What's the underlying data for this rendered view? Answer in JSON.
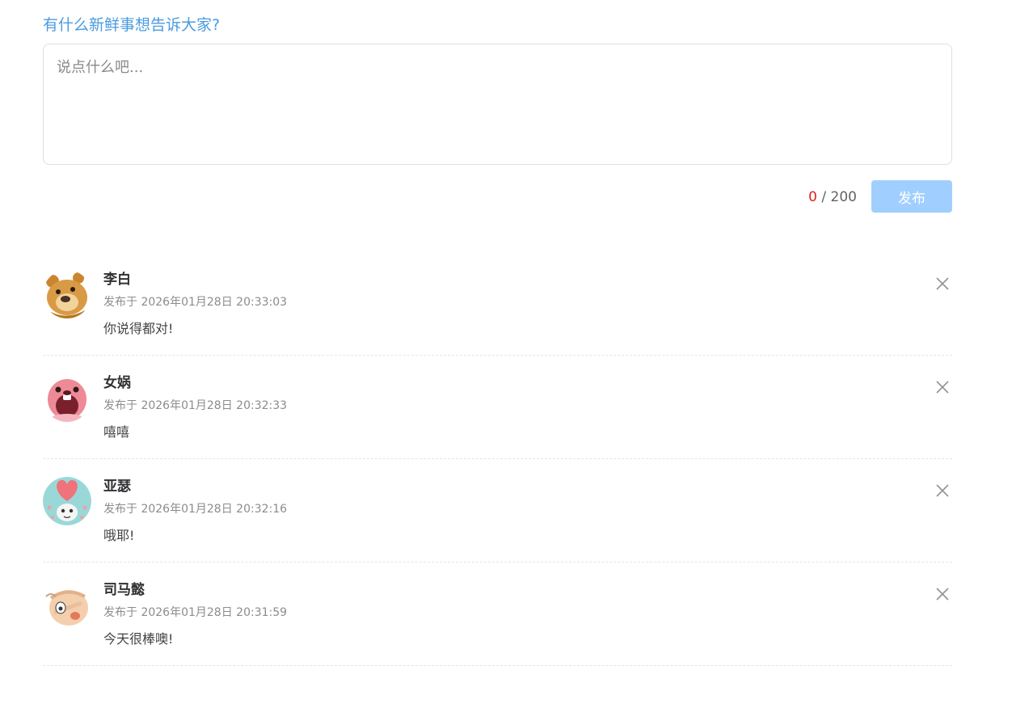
{
  "composer": {
    "prompt": "有什么新鲜事想告诉大家?",
    "placeholder": "说点什么吧...",
    "count_current": "0",
    "count_separator": " / ",
    "count_max": "200",
    "publish_label": "发布"
  },
  "comments": [
    {
      "avatar_icon": "bear-avatar-icon",
      "name": "李白",
      "time": "发布于 2026年01月28日 20:33:03",
      "content": "你说得都对!",
      "delete_icon": "close-icon"
    },
    {
      "avatar_icon": "pink-beaver-avatar-icon",
      "name": "女娲",
      "time": "发布于 2026年01月28日 20:32:33",
      "content": "嘻嘻",
      "delete_icon": "close-icon"
    },
    {
      "avatar_icon": "heart-character-avatar-icon",
      "name": "亚瑟",
      "time": "发布于 2026年01月28日 20:32:16",
      "content": "哦耶!",
      "delete_icon": "close-icon"
    },
    {
      "avatar_icon": "bandaged-face-avatar-icon",
      "name": "司马懿",
      "time": "发布于 2026年01月28日 20:31:59",
      "content": "今天很棒噢!",
      "delete_icon": "close-icon"
    }
  ],
  "colors": {
    "prompt": "#4a9be0",
    "counter_current": "#e02020",
    "publish_disabled_bg": "#a0cfff"
  }
}
